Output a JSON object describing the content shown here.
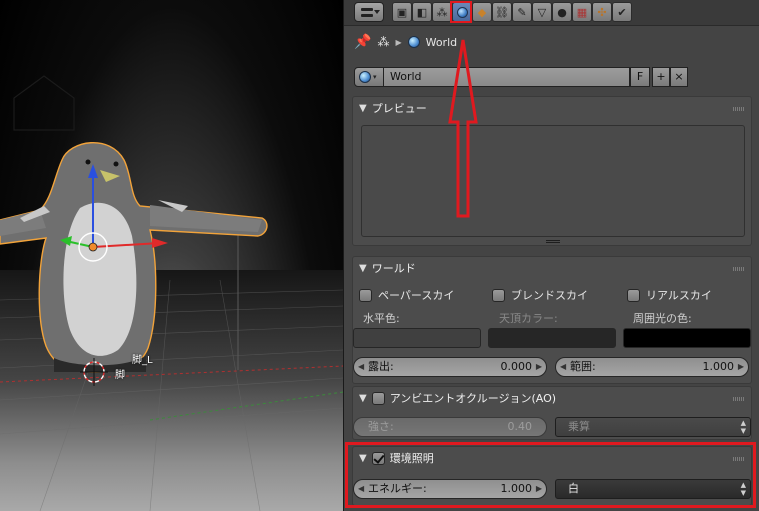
{
  "viewport": {
    "bone_labels": [
      "脚_L",
      "脚"
    ]
  },
  "properties": {
    "context_tabs": [
      {
        "icon": "render-icon"
      },
      {
        "icon": "render-layers-icon"
      },
      {
        "icon": "scene-icon"
      },
      {
        "icon": "world-icon",
        "active": true
      },
      {
        "icon": "object-icon"
      },
      {
        "icon": "constraints-icon"
      },
      {
        "icon": "modifiers-icon"
      },
      {
        "icon": "object-data-icon"
      },
      {
        "icon": "material-icon"
      },
      {
        "icon": "texture-icon"
      },
      {
        "icon": "particles-icon"
      },
      {
        "icon": "physics-icon"
      }
    ],
    "breadcrumb": {
      "label": "World"
    },
    "id_block": {
      "name": "World",
      "fake_user": "F",
      "add": "+",
      "unlink": "×"
    },
    "preview": {
      "title": "プレビュー"
    },
    "world": {
      "title": "ワールド",
      "paper_sky": "ペーパースカイ",
      "blend_sky": "ブレンドスカイ",
      "real_sky": "リアルスカイ",
      "horizon_label": "水平色:",
      "zenith_label": "天頂カラー:",
      "ambient_label": "周囲光の色:",
      "horizon_color": "#404040",
      "zenith_color": "#262626",
      "ambient_color": "#000000",
      "exposure_label": "露出:",
      "exposure_value": "0.000",
      "range_label": "範囲:",
      "range_value": "1.000"
    },
    "ao": {
      "title": "アンビエントオクルージョン(AO)",
      "strength_label": "強さ:",
      "strength_value": "0.40",
      "blend_mode": "乗算"
    },
    "env_light": {
      "title": "環境照明",
      "energy_label": "エネルギー:",
      "energy_value": "1.000",
      "color_mode": "白"
    }
  },
  "annotation": {
    "color": "#e0191f"
  }
}
